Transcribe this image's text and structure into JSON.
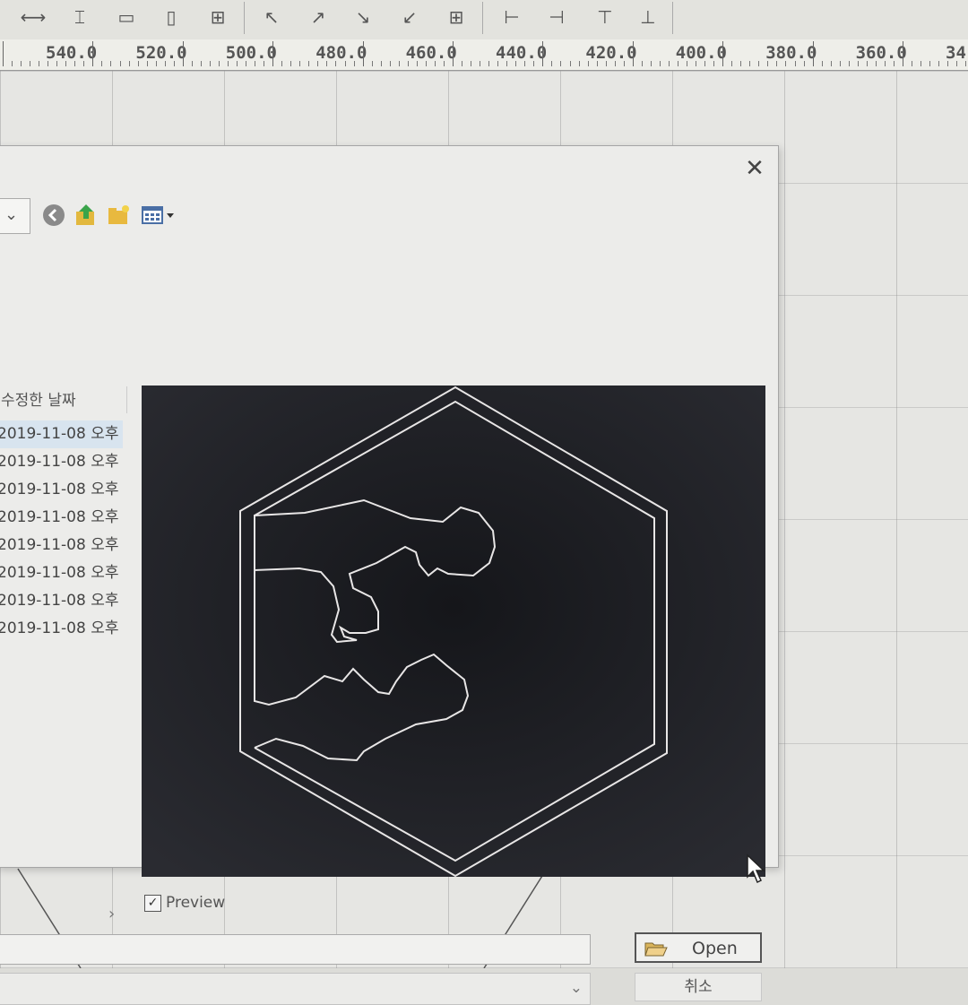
{
  "ruler": {
    "labels": [
      "540.0",
      "520.0",
      "500.0",
      "480.0",
      "460.0",
      "440.0",
      "420.0",
      "400.0",
      "380.0",
      "360.0",
      "34"
    ]
  },
  "toolbar": {
    "icons": [
      "distribute-horizontal-icon",
      "distribute-vertical-icon",
      "same-height-icon",
      "same-width-icon",
      "center-icon",
      "align-top-left-icon",
      "align-top-right-icon",
      "align-bottom-right-icon",
      "align-bottom-left-icon",
      "align-center-icon",
      "align-left-icon",
      "align-right-icon",
      "align-top-icon",
      "align-bottom-icon"
    ]
  },
  "dialog": {
    "close_label": "✕",
    "list_header": "수정한 날짜",
    "files": [
      {
        "date": "2019-11-08 오후"
      },
      {
        "date": "2019-11-08 오후"
      },
      {
        "date": "2019-11-08 오후"
      },
      {
        "date": "2019-11-08 오후"
      },
      {
        "date": "2019-11-08 오후"
      },
      {
        "date": "2019-11-08 오후"
      },
      {
        "date": "2019-11-08 오후"
      },
      {
        "date": "2019-11-08 오후"
      }
    ],
    "preview_checkbox_label": "Preview",
    "preview_checked": true,
    "open_button": "Open",
    "cancel_button": "취소",
    "filename_value": "",
    "filetype_value": ""
  },
  "colors": {
    "preview_background": "#222328",
    "selected_row": "#d8e4ef"
  }
}
